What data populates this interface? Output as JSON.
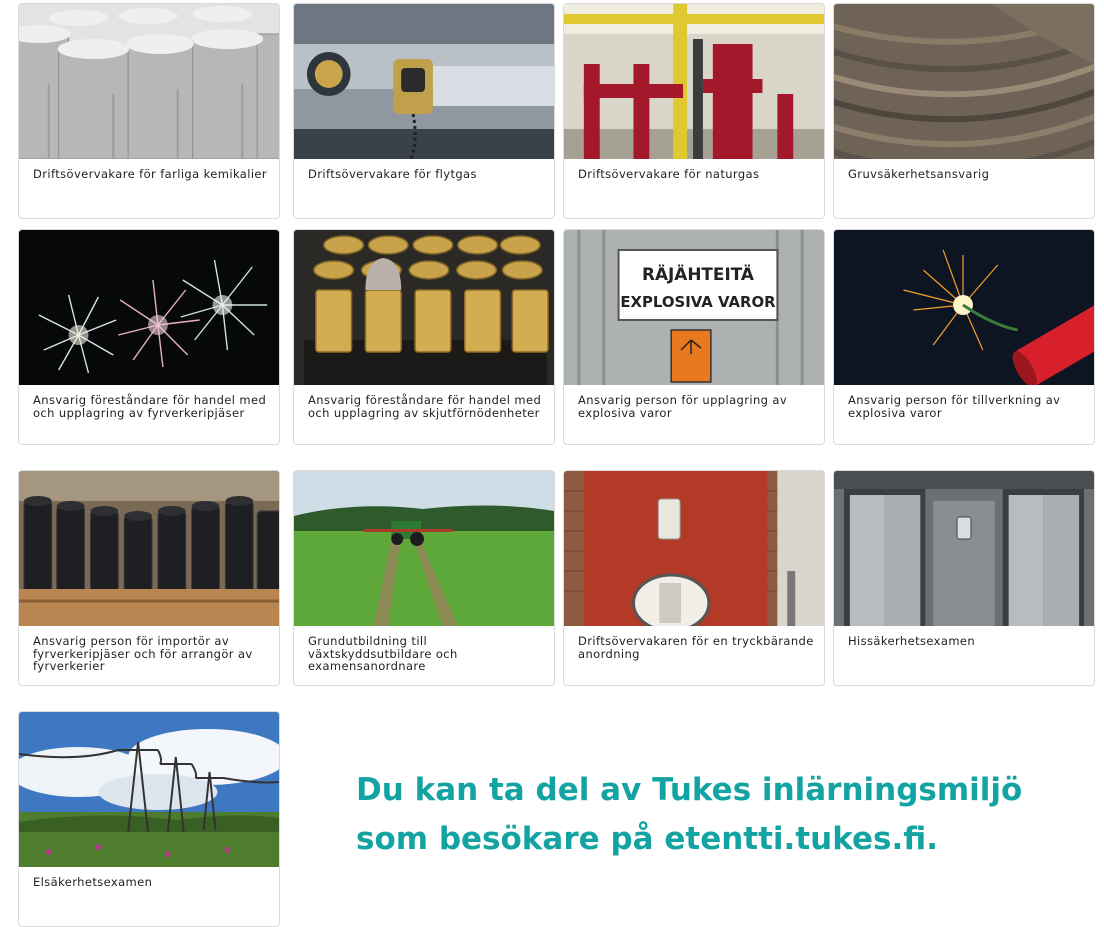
{
  "cards": [
    {
      "title": "Driftsövervakare för farliga kemikalier",
      "image": "chemical-tanks"
    },
    {
      "title": "Driftsövervakare för flytgas",
      "image": "gas-valve"
    },
    {
      "title": "Driftsövervakare för naturgas",
      "image": "red-gas-pipes"
    },
    {
      "title": "Gruvsäkerhetsansvarig",
      "image": "open-pit-mine"
    },
    {
      "title": "Ansvarig föreståndare för handel med och upplagring av fyrverkeripjäser",
      "image": "fireworks-sky"
    },
    {
      "title": "Ansvarig föreståndare för handel med och upplagring av skjutförnödenheter",
      "image": "ammunition-cartridges"
    },
    {
      "title": "Ansvarig person för upplagring av explosiva varor",
      "image": "explosives-warning-sign"
    },
    {
      "title": "Ansvarig person för tillverkning av explosiva varor",
      "image": "burning-fuse"
    },
    {
      "title": "Ansvarig person för importör av fyrverkeripjäser och för arrangör av fyrverkerier",
      "image": "firework-tubes"
    },
    {
      "title": "Grundutbildning till växtskyddsutbildare och examensanordnare",
      "image": "tractor-field"
    },
    {
      "title": "Driftsövervakaren för en tryckbärande anordning",
      "image": "pressure-vessel"
    },
    {
      "title": "Hissäkerhetsexamen",
      "image": "elevator-doors"
    },
    {
      "title": "Elsäkerhetsexamen",
      "image": "power-lines"
    }
  ],
  "sign": {
    "line1": "RÄJÄHTEITÄ",
    "line2": "EXPLOSIVA VAROR"
  },
  "promo": {
    "line1": "Du kan ta del av Tukes inlärningsmiljö",
    "line2": "som besökare på etentti.tukes.fi."
  },
  "colors": {
    "promo": "#14a3a3",
    "card_border": "#dadada"
  }
}
